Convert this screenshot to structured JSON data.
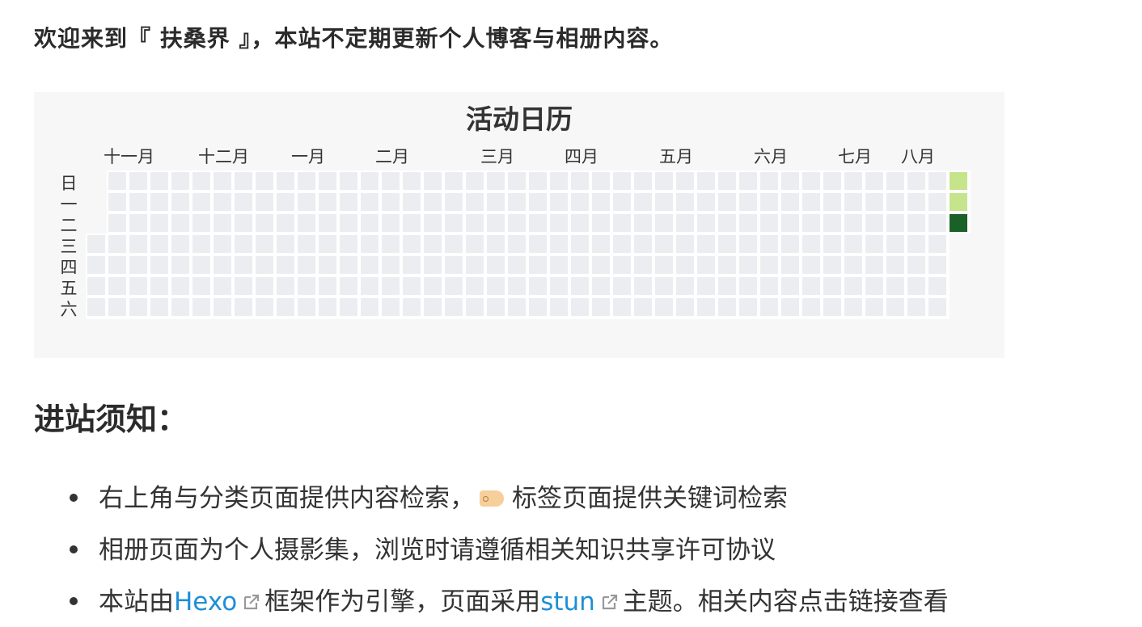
{
  "intro": {
    "text": "欢迎来到『 扶桑界 』，本站不定期更新个人博客与相册内容。"
  },
  "calendar": {
    "title": "活动日历",
    "months": [
      "十一月",
      "十二月",
      "一月",
      "二月",
      "三月",
      "四月",
      "五月",
      "六月",
      "七月",
      "八月"
    ],
    "weekdays": [
      "日",
      "一",
      "二",
      "三",
      "四",
      "五",
      "六"
    ],
    "colors": {
      "empty": "#ebedf0",
      "level1": "#c6e48b",
      "level4": "#196127"
    },
    "week_count": 42,
    "first_week_start_row": 3,
    "last_week_end_row": 2,
    "activity": [
      {
        "week": 41,
        "day": 0,
        "level": 1
      },
      {
        "week": 41,
        "day": 1,
        "level": 1
      },
      {
        "week": 41,
        "day": 2,
        "level": 4
      }
    ]
  },
  "notice": {
    "title": "进站须知：",
    "items": [
      {
        "text_before": "右上角与分类页面提供内容检索，",
        "icon": "tag-icon",
        "text_after": "标签页面提供关键词检索"
      },
      {
        "text": "相册页面为个人摄影集，浏览时请遵循相关知识共享许可协议"
      },
      {
        "text_1": "本站由",
        "link_1": "Hexo",
        "link_1_icon": "external-link-icon",
        "text_2": "框架作为引擎，页面采用",
        "link_2": "stun",
        "link_2_icon": "external-link-icon",
        "text_3": "主题。相关内容点击链接查看"
      }
    ]
  }
}
